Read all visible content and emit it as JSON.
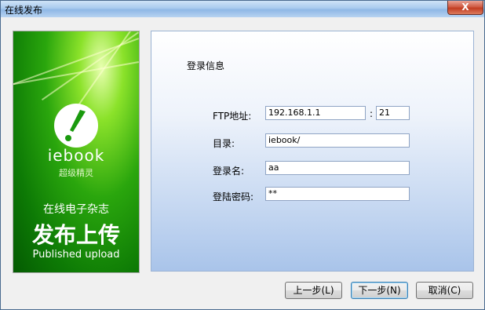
{
  "window": {
    "title": "在线发布",
    "close_label": "X"
  },
  "banner": {
    "brand": "iebook",
    "brand_sub": "超级精灵",
    "line1": "在线电子杂志",
    "line2": "发布上传",
    "line3": "Published upload",
    "brand_color": "#1a9a0e"
  },
  "form": {
    "section_title": "登录信息",
    "ftp_label": "FTP地址:",
    "ftp_host": "192.168.1.1",
    "port_sep": ":",
    "ftp_port": "21",
    "dir_label": "目录:",
    "dir_value": "iebook/",
    "user_label": "登录名:",
    "user_value": "aa",
    "password_label": "登陆密码:",
    "password_value": "**"
  },
  "buttons": {
    "back": "上一步(L)",
    "next": "下一步(N)",
    "cancel": "取消(C)"
  }
}
